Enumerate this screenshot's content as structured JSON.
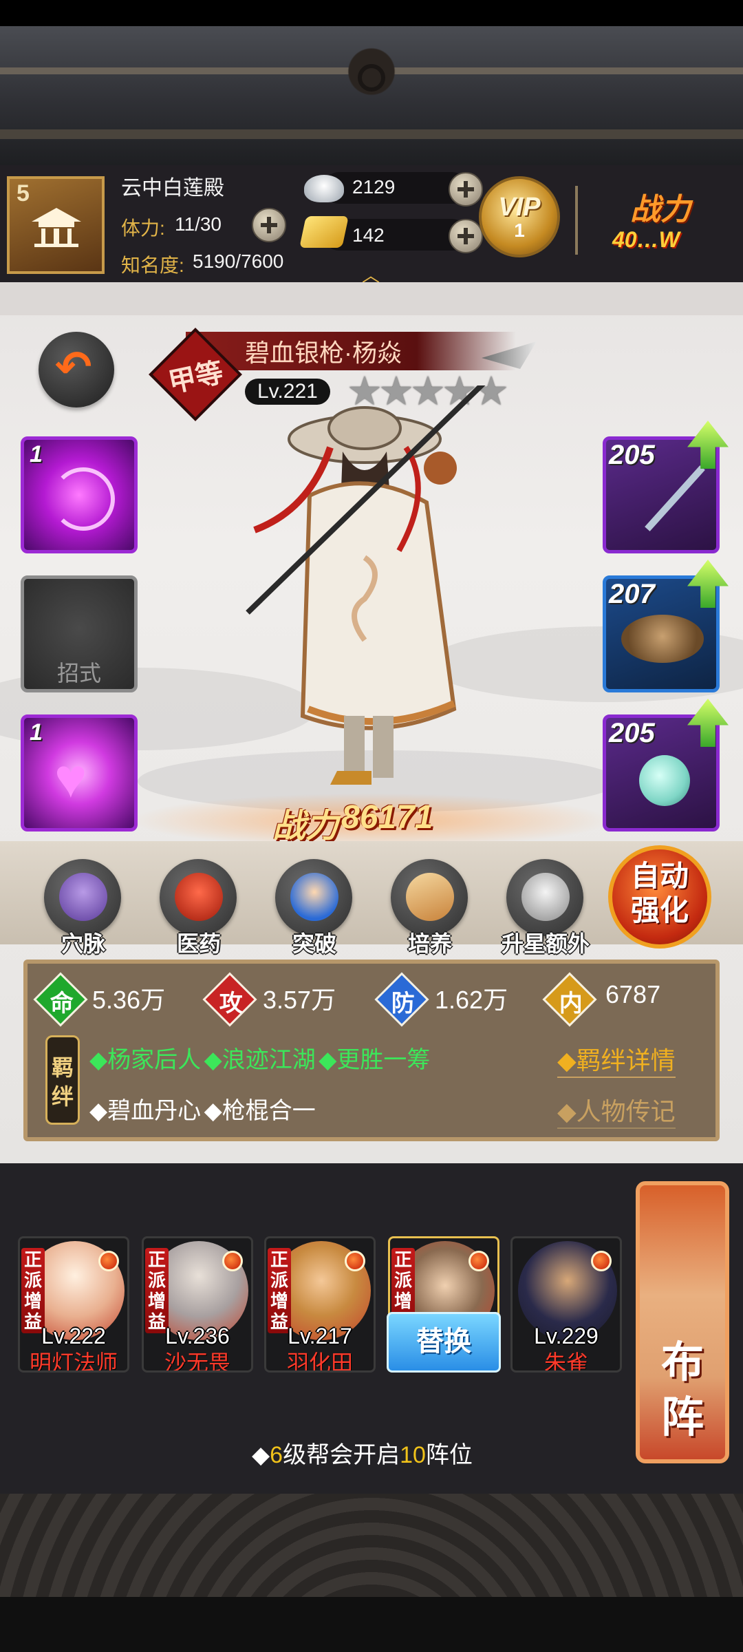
{
  "header": {
    "sect_level": "5",
    "sect_name": "云中白莲殿",
    "stamina_label": "体力:",
    "stamina_value": "11/30",
    "fame_label": "知名度:",
    "fame_value": "5190/7600",
    "silver": "2129",
    "gold": "142",
    "vip_label": "VIP",
    "vip_level": "1",
    "power_label": "战力",
    "power_value": "40…W"
  },
  "hero": {
    "grade": "甲等",
    "name": "碧血银枪·杨焱",
    "level": "Lv.221",
    "stars": 5,
    "power_label": "战力",
    "power_value": "86171"
  },
  "skills": [
    {
      "count": "1",
      "type": "swirl"
    },
    {
      "label": "招式"
    },
    {
      "count": "1",
      "type": "heart"
    }
  ],
  "equipment": [
    {
      "level": "205",
      "slot": "weapon"
    },
    {
      "level": "207",
      "slot": "hat"
    },
    {
      "level": "205",
      "slot": "amulet"
    }
  ],
  "actions": [
    {
      "label": "穴脉",
      "icon": "meridian-icon"
    },
    {
      "label": "医药",
      "icon": "medicine-icon"
    },
    {
      "label": "突破",
      "icon": "breakthrough-icon"
    },
    {
      "label": "培养",
      "icon": "cultivate-icon"
    },
    {
      "label": "升星额外",
      "icon": "star-up-icon"
    }
  ],
  "auto_enhance": {
    "line1": "自动",
    "line2": "强化"
  },
  "stats": {
    "hp": {
      "icon_char": "命",
      "value": "5.36万"
    },
    "atk": {
      "icon_char": "攻",
      "value": "3.57万"
    },
    "def": {
      "icon_char": "防",
      "value": "1.62万"
    },
    "int": {
      "icon_char": "内",
      "value": "6787"
    }
  },
  "bonds": {
    "badge": "羁绊",
    "row1": [
      "◆杨家后人",
      "◆浪迹江湖",
      "◆更胜一筹"
    ],
    "row2": [
      "◆碧血丹心",
      "◆枪棍合一"
    ],
    "details_link": "◆羁绊详情",
    "biography_link": "◆人物传记"
  },
  "lineup": [
    {
      "faction": "正派增益",
      "level": "Lv.222",
      "name": "明灯法师"
    },
    {
      "faction": "正派增益",
      "level": "Lv.236",
      "name": "沙无畏"
    },
    {
      "faction": "正派增益",
      "level": "Lv.217",
      "name": "羽化田"
    },
    {
      "faction": "正派增益",
      "level": "",
      "name": ""
    },
    {
      "faction": "",
      "level": "Lv.229",
      "name": "朱雀"
    }
  ],
  "replace_button": "替换",
  "formation_button": "布阵",
  "unlock_hint": {
    "prefix": "◆",
    "num1": "6",
    "mid": "级帮会开启",
    "num2": "10",
    "suffix": "阵位"
  },
  "colors": {
    "accent_gold": "#e2b448",
    "stat_hp": "#1fa82c",
    "stat_atk": "#c82424",
    "stat_def": "#2a6ad6",
    "stat_int": "#d69a1a",
    "bond_active": "#3ce65a",
    "name_red": "#ff3a2a"
  }
}
